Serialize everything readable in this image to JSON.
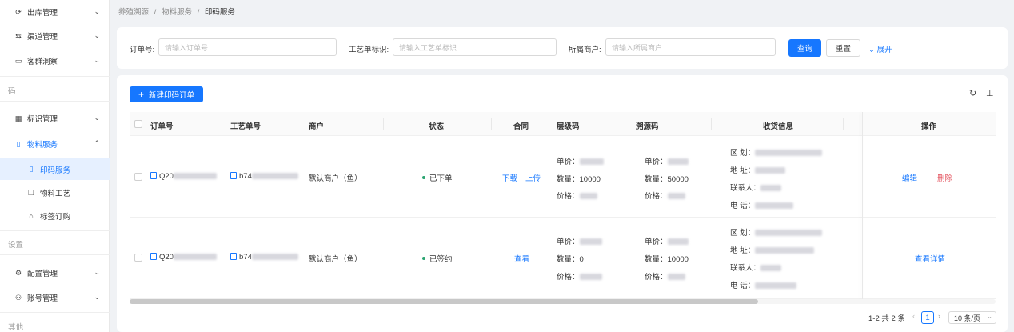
{
  "sidebar": {
    "items": [
      {
        "label": "出库管理",
        "icon": "outbound-icon"
      },
      {
        "label": "渠道管理",
        "icon": "channel-icon"
      },
      {
        "label": "客群洞察",
        "icon": "insight-icon"
      }
    ],
    "group_code": "码",
    "code_items": [
      {
        "label": "标识管理",
        "icon": "qr-icon"
      },
      {
        "label": "物料服务",
        "icon": "file-icon"
      }
    ],
    "sub_items": [
      {
        "label": "印码服务",
        "icon": "file-icon"
      },
      {
        "label": "物料工艺",
        "icon": "copy-icon"
      },
      {
        "label": "标签订购",
        "icon": "tag-icon"
      }
    ],
    "group_settings": "设置",
    "settings_items": [
      {
        "label": "配置管理",
        "icon": "gear-icon"
      },
      {
        "label": "账号管理",
        "icon": "account-icon"
      }
    ],
    "group_other": "其他"
  },
  "breadcrumb": [
    "养殖溯源",
    "/",
    "物料服务",
    "/",
    "印码服务"
  ],
  "search": {
    "order_label": "订单号:",
    "order_placeholder": "请输入订单号",
    "craft_label": "工艺单标识:",
    "craft_placeholder": "请输入工艺单标识",
    "merchant_label": "所属商户:",
    "merchant_placeholder": "请输入所属商户",
    "query_button": "查询",
    "reset_button": "重置",
    "expand_link": "展开"
  },
  "table": {
    "new_button": "新建印码订单",
    "headers": [
      "订单号",
      "工艺单号",
      "商户",
      "状态",
      "合同",
      "层级码",
      "溯源码",
      "收货信息",
      "操作"
    ],
    "rows": [
      {
        "order": "Q20",
        "craft": "b74",
        "merchant": "默认商户（鱼）",
        "status": "已下单",
        "contract": [
          "下载",
          "上传"
        ],
        "level_unit": "单价：",
        "level_qty": "数量：10000",
        "level_price": "价格：",
        "trace_unit": "单价：",
        "trace_qty": "数量：50000",
        "trace_price": "价格：",
        "area": "区 划：",
        "address": "地 址：",
        "contact": "联系人：",
        "phone": "电 话：",
        "actions": [
          "编辑",
          "删除"
        ]
      },
      {
        "order": "Q20",
        "craft": "b74",
        "merchant": "默认商户（鱼）",
        "status": "已签约",
        "contract": [
          "查看"
        ],
        "level_unit": "单价：",
        "level_qty": "数量：0",
        "level_price": "价格：",
        "trace_unit": "单价：",
        "trace_qty": "数量：10000",
        "trace_price": "价格：",
        "area": "区 划：",
        "address": "地 址：",
        "contact": "联系人：",
        "phone": "电 话：",
        "actions": [
          "查看详情"
        ]
      }
    ]
  },
  "pagination": {
    "summary": "1-2 共 2 条",
    "current_page": "1",
    "page_size": "10 条/页"
  },
  "colors": {
    "primary": "#1677ff",
    "danger": "#e34d59",
    "success": "#2ba471"
  }
}
